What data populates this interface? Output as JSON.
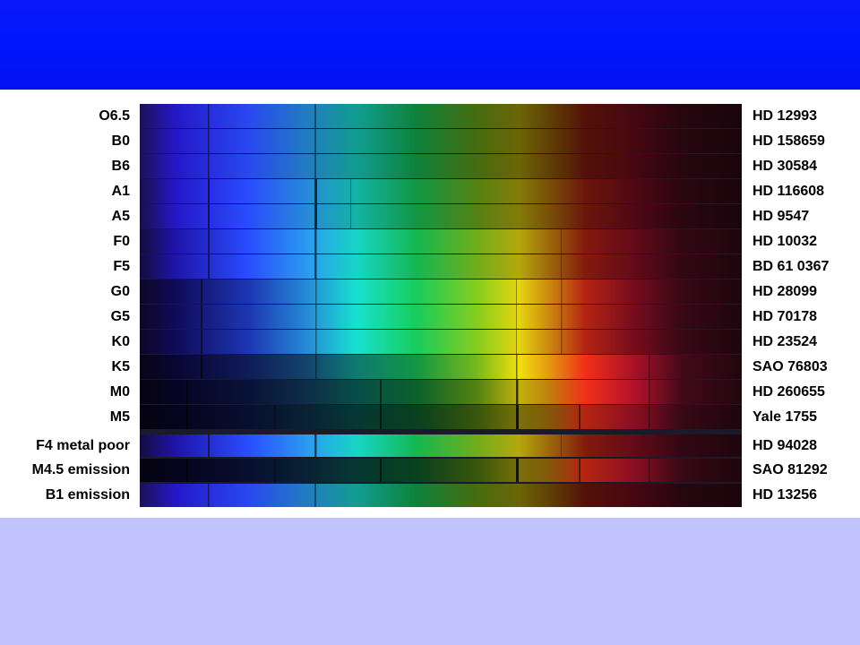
{
  "spectra": [
    {
      "type": "O6.5",
      "star": "HD 12993",
      "profile": "hot"
    },
    {
      "type": "B0",
      "star": "HD 158659",
      "profile": "hot"
    },
    {
      "type": "B6",
      "star": "HD 30584",
      "profile": "hot"
    },
    {
      "type": "A1",
      "star": "HD 116608",
      "profile": "warm"
    },
    {
      "type": "A5",
      "star": "HD 9547",
      "profile": "warm"
    },
    {
      "type": "F0",
      "star": "HD 10032",
      "profile": "mid"
    },
    {
      "type": "F5",
      "star": "BD 61 0367",
      "profile": "mid"
    },
    {
      "type": "G0",
      "star": "HD 28099",
      "profile": "sun"
    },
    {
      "type": "G5",
      "star": "HD 70178",
      "profile": "sun"
    },
    {
      "type": "K0",
      "star": "HD 23524",
      "profile": "sun"
    },
    {
      "type": "K5",
      "star": "SAO 76803",
      "profile": "cool"
    },
    {
      "type": "M0",
      "star": "HD 260655",
      "profile": "cooler"
    },
    {
      "type": "M5",
      "star": "Yale 1755",
      "profile": "coolest"
    },
    {
      "type": "F4 metal poor",
      "star": "HD 94028",
      "profile": "mid"
    },
    {
      "type": "M4.5 emission",
      "star": "SAO 81292",
      "profile": "coolest"
    },
    {
      "type": "B1 emission",
      "star": "HD 13256",
      "profile": "hot"
    }
  ],
  "colors": {
    "top_band": "#0018ff",
    "bottom_band": "#c2c2fc"
  }
}
